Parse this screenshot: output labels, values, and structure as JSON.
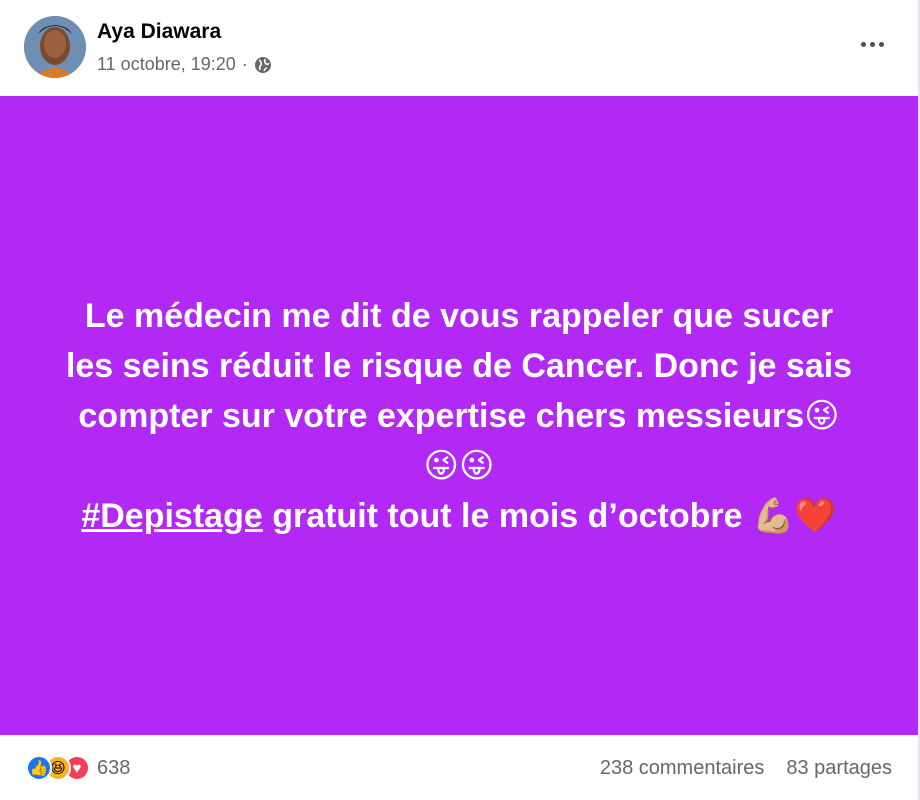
{
  "post": {
    "author": "Aya Diawara",
    "timestamp": "11 octobre, 19:20",
    "separator": "·",
    "privacy_icon": "globe-icon",
    "more_icon": "more-horizontal-icon",
    "background_color": "#b228f5",
    "text_lines": {
      "line1": "Le médecin me dit de vous rappeler que sucer",
      "line2": "les seins réduit le risque de Cancer. Donc je sais",
      "line3": "compter sur votre expertise chers messieurs😜",
      "line4": "😜😜",
      "hashtag": "#Depistage",
      "line5_rest": " gratuit tout le mois d’octobre 💪🏼❤️"
    }
  },
  "footer": {
    "reactions": [
      {
        "type": "like",
        "glyph": "👍"
      },
      {
        "type": "haha",
        "glyph": "😆"
      },
      {
        "type": "love",
        "glyph": "♥"
      }
    ],
    "reaction_count": "638",
    "comments": "238 commentaires",
    "shares": "83 partages"
  }
}
